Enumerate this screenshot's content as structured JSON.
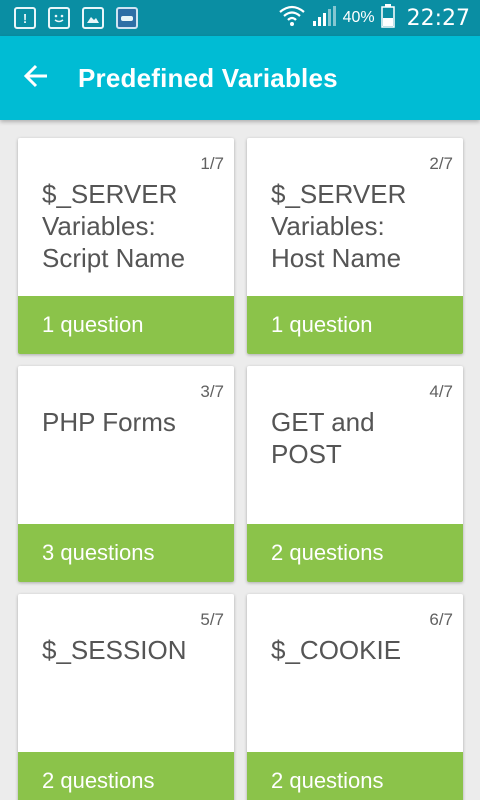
{
  "status_bar": {
    "icons": [
      "alert-icon",
      "face-icon",
      "image-icon",
      "app-icon"
    ],
    "battery_percent": "40%",
    "time": "22:27"
  },
  "app_bar": {
    "title": "Predefined Variables",
    "back_icon": "arrow-left-icon"
  },
  "colors": {
    "status_bar": "#0a8ea3",
    "app_bar": "#00bcd4",
    "card_footer": "#8bc34a",
    "background": "#ececec"
  },
  "cards": [
    {
      "counter": "1/7",
      "title": "$_SERVER Variables: Script Name",
      "questions": "1 question"
    },
    {
      "counter": "2/7",
      "title": "$_SERVER Variables: Host Name",
      "questions": "1 question"
    },
    {
      "counter": "3/7",
      "title": "PHP Forms",
      "questions": "3 questions"
    },
    {
      "counter": "4/7",
      "title": "GET and POST",
      "questions": "2 questions"
    },
    {
      "counter": "5/7",
      "title": "$_SESSION",
      "questions": "2 questions"
    },
    {
      "counter": "6/7",
      "title": "$_COOKIE",
      "questions": "2 questions"
    }
  ]
}
